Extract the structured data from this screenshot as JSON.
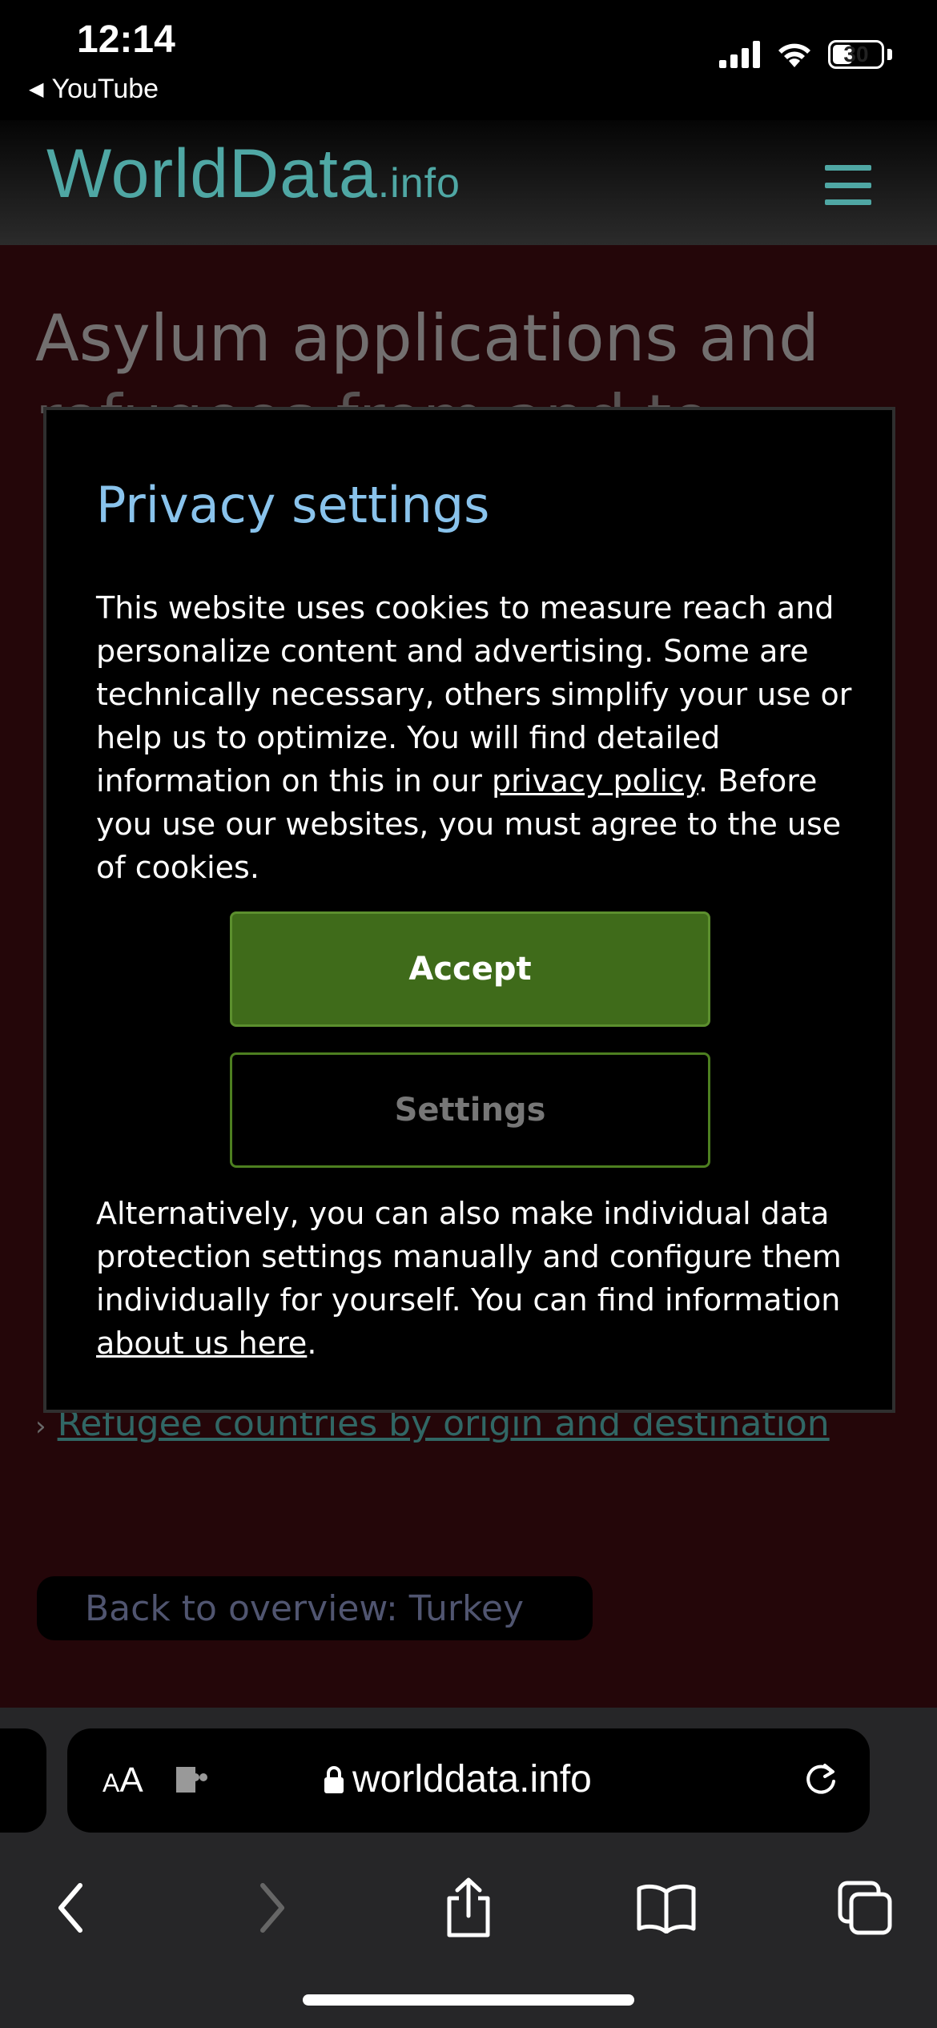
{
  "status_bar": {
    "time": "12:14",
    "back_app": "YouTube",
    "battery": "30"
  },
  "site": {
    "logo_main": "WorldData",
    "logo_suffix": ".info"
  },
  "page": {
    "title_line1": "Asylum applications and",
    "title_line2": "refugees from and to",
    "link_marker": "›",
    "refugee_link": "Refugee countries by origin and destination",
    "back_overview": "Back to overview: Turkey"
  },
  "modal": {
    "title": "Privacy settings",
    "intro_text": "This website uses cookies to measure reach and personalize content and advertising. Some are technically necessary, others simplify your use or help us to optimize. You will find detailed information on this in our ",
    "privacy_link": "privacy policy",
    "intro_text_end": ". Before you use our websites, you must agree to the use of cookies.",
    "accept_label": "Accept",
    "settings_label": "Settings",
    "alt_text": "Alternatively, you can also make individual data protection settings manually and configure them individually for yourself. You can find information ",
    "about_link": "about us here",
    "alt_text_end": "."
  },
  "browser": {
    "aa_small": "A",
    "aa_large": "A",
    "url": "worlddata.info"
  },
  "colors": {
    "accent_teal": "#4fa7a4",
    "modal_title": "#89c3ec",
    "accept_green": "#3f6b1a",
    "page_bg": "#3a0a0f"
  },
  "icons": [
    "cellular-signal-icon",
    "wifi-icon",
    "battery-icon",
    "hamburger-menu-icon",
    "extension-icon",
    "lock-icon",
    "reload-icon",
    "back-icon",
    "forward-icon",
    "share-icon",
    "bookmarks-icon",
    "tabs-icon"
  ]
}
